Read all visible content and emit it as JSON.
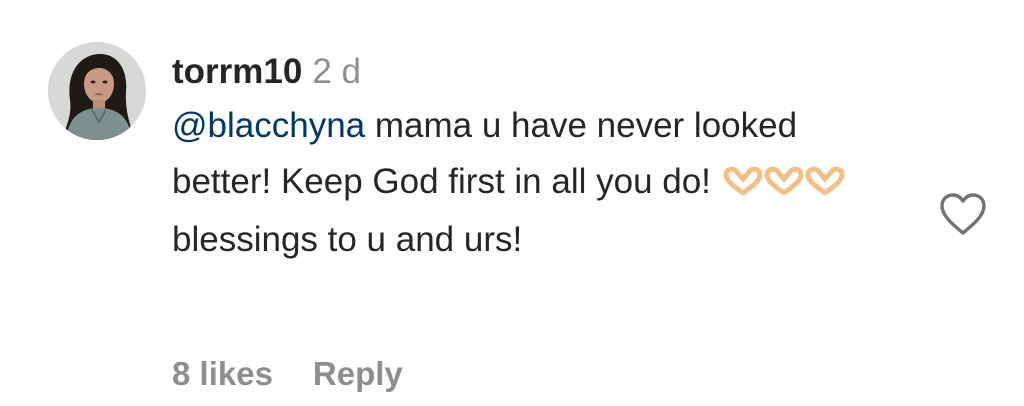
{
  "comment": {
    "username": "torrm10",
    "timestamp": "2 d",
    "mention": "@blacchyna",
    "text_part1": " mama u have never looked better! Keep God first in all you do! ",
    "emoji": "🫶🫶🫶",
    "text_part2": " blessings to u and urs!",
    "likes_label": "8 likes",
    "reply_label": "Reply",
    "avatar_icon": "profile-photo",
    "like_icon": "heart-outline-icon"
  },
  "colors": {
    "text": "#262626",
    "muted": "#8e8e8e",
    "mention": "#00376b"
  }
}
